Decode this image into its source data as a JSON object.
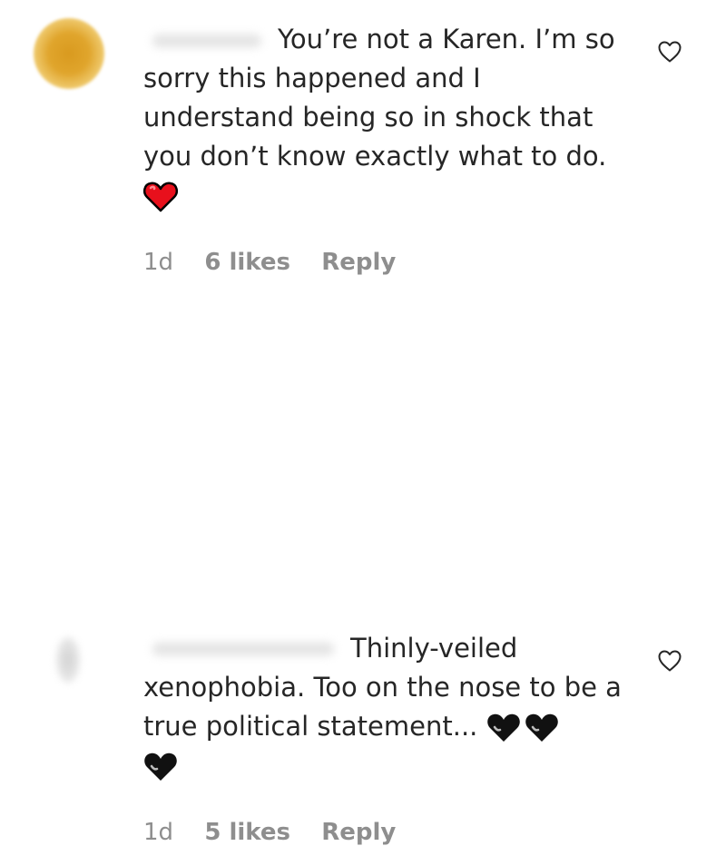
{
  "comments": [
    {
      "username": "",
      "text_first": "You’re not a Karen. I’m so",
      "text_rest": "sorry this happened and I understand being so in shock that you don’t know exactly what to do.",
      "emojis": [
        "red-heart"
      ],
      "time": "1d",
      "likes": "6 likes",
      "reply": "Reply",
      "like_icon": "heart-outline-icon"
    },
    {
      "username": "",
      "text_first": "Thinly-veiled",
      "text_rest": "xenophobia. Too on the nose to be a true political statement...",
      "emojis": [
        "black-heart",
        "black-heart",
        "black-heart"
      ],
      "time": "1d",
      "likes": "5 likes",
      "reply": "Reply",
      "like_icon": "heart-outline-icon"
    }
  ],
  "colors": {
    "text": "#262626",
    "meta": "#8e8e8e",
    "red_heart": "#e8101c",
    "black_heart": "#111111"
  }
}
